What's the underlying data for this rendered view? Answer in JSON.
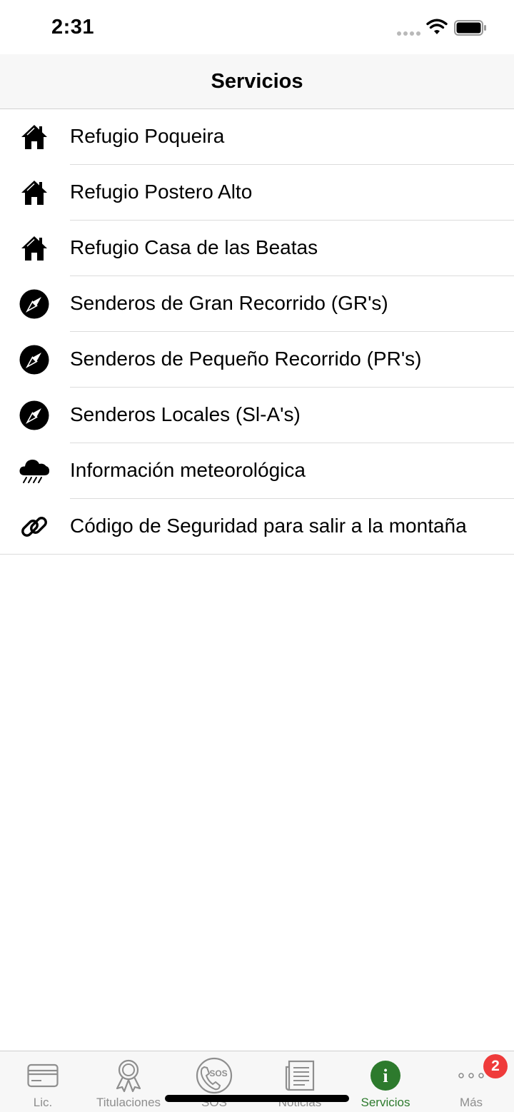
{
  "status": {
    "time": "2:31"
  },
  "nav": {
    "title": "Servicios"
  },
  "list": [
    {
      "label": "Refugio Poqueira",
      "icon": "house-icon"
    },
    {
      "label": "Refugio Postero Alto",
      "icon": "house-icon"
    },
    {
      "label": "Refugio Casa de las Beatas",
      "icon": "house-icon"
    },
    {
      "label": "Senderos de Gran Recorrido (GR's)",
      "icon": "compass-icon"
    },
    {
      "label": "Senderos de Pequeño Recorrido (PR's)",
      "icon": "compass-icon"
    },
    {
      "label": "Senderos Locales (Sl-A's)",
      "icon": "compass-icon"
    },
    {
      "label": "Información meteorológica",
      "icon": "rain-cloud-icon"
    },
    {
      "label": "Código de Seguridad para salir a la montaña",
      "icon": "link-icon"
    }
  ],
  "tabs": [
    {
      "label": "Lic.",
      "icon": "license-card-icon"
    },
    {
      "label": "Titulaciones",
      "icon": "award-ribbon-icon"
    },
    {
      "label": "SOS",
      "icon": "sos-phone-icon"
    },
    {
      "label": "Noticias",
      "icon": "newspaper-icon"
    },
    {
      "label": "Servicios",
      "icon": "info-icon",
      "active": true
    },
    {
      "label": "Más",
      "icon": "more-dots-icon"
    }
  ],
  "badge": {
    "count": "2"
  },
  "colors": {
    "active_tab": "#2d7a2d",
    "inactive_tab": "#8e8e8e",
    "badge": "#ef3b3b"
  }
}
